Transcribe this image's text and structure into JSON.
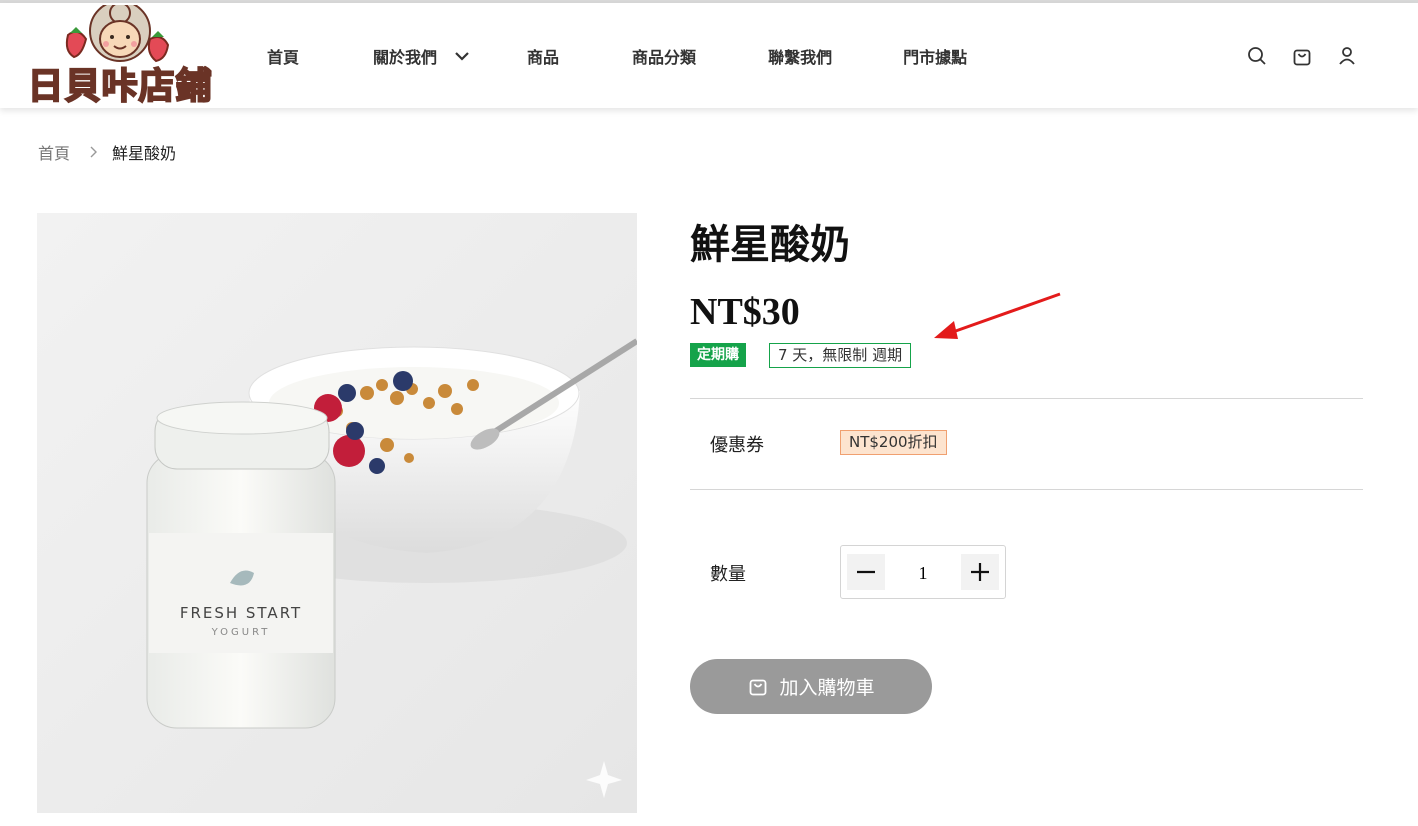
{
  "header": {
    "logo_text": "日貝咔店鋪",
    "nav": [
      "首頁",
      "關於我們",
      "商品",
      "商品分類",
      "聯繫我們",
      "門市據點"
    ],
    "icons": [
      "search-icon",
      "cart-icon",
      "user-icon"
    ]
  },
  "breadcrumb": {
    "home": "首頁",
    "current": "鮮星酸奶"
  },
  "product": {
    "title": "鮮星酸奶",
    "price": "NT$30",
    "subscription_badge": "定期購",
    "cycle_text": "7 天，無限制 週期",
    "coupon_label": "優惠券",
    "coupon_value": "NT$200折扣",
    "quantity_label": "數量",
    "quantity": "1",
    "add_to_cart": "加入購物車",
    "image": {
      "jar_label_line1": "FRESH START",
      "jar_label_line2": "YOGURT"
    }
  },
  "colors": {
    "accent_green": "#15a34a",
    "coupon_bg": "#fde4cf",
    "button_gray": "#9a9a9a",
    "annotation_arrow": "#e31b1b"
  }
}
